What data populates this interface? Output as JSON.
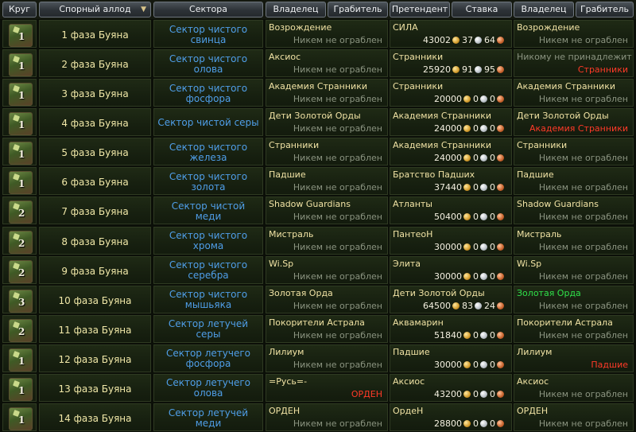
{
  "header": {
    "round": "Круг",
    "allod": "Спорный аллод",
    "sectors": "Сектора",
    "owner": "Владелец",
    "robber": "Грабитель",
    "claimant": "Претендент",
    "stake": "Ставка",
    "owner2": "Владелец",
    "robber2": "Грабитель",
    "sort_icon": "sort-desc-arrow"
  },
  "rows": [
    {
      "round": "1",
      "allod": "1 фаза Буяна",
      "sector": "Сектор чистого свинца",
      "owner": "Возрождение",
      "robber": "Никем не ограблен",
      "robber_style": "gray",
      "claimant": "СИЛА",
      "gold": "43002",
      "silver": "37",
      "copper": "64",
      "owner2": "Возрождение",
      "owner2_style": "normal",
      "robber2": "Никем не ограблен",
      "robber2_style": "gray"
    },
    {
      "round": "1",
      "allod": "2 фаза Буяна",
      "sector": "Сектор чистого олова",
      "owner": "Аксиос",
      "robber": "Никем не ограблен",
      "robber_style": "gray",
      "claimant": "Странники",
      "gold": "25920",
      "silver": "91",
      "copper": "95",
      "owner2": "Никому не принадлежит",
      "owner2_style": "gray",
      "robber2": "Странники",
      "robber2_style": "red"
    },
    {
      "round": "1",
      "allod": "3 фаза Буяна",
      "sector": "Сектор чистого фосфора",
      "owner": "Академия Странники",
      "robber": "Никем не ограблен",
      "robber_style": "gray",
      "claimant": "Странники",
      "gold": "20000",
      "silver": "0",
      "copper": "0",
      "owner2": "Академия Странники",
      "owner2_style": "normal",
      "robber2": "Никем не ограблен",
      "robber2_style": "gray"
    },
    {
      "round": "1",
      "allod": "4 фаза Буяна",
      "sector": "Сектор чистой серы",
      "owner": "Дети Золотой Орды",
      "robber": "Никем не ограблен",
      "robber_style": "gray",
      "claimant": "Академия Странники",
      "gold": "24000",
      "silver": "0",
      "copper": "0",
      "owner2": "Дети Золотой Орды",
      "owner2_style": "normal",
      "robber2": "Академия Странники",
      "robber2_style": "red"
    },
    {
      "round": "1",
      "allod": "5 фаза Буяна",
      "sector": "Сектор чистого железа",
      "owner": "Странники",
      "robber": "Никем не ограблен",
      "robber_style": "gray",
      "claimant": "Академия Странники",
      "gold": "24000",
      "silver": "0",
      "copper": "0",
      "owner2": "Странники",
      "owner2_style": "normal",
      "robber2": "Никем не ограблен",
      "robber2_style": "gray"
    },
    {
      "round": "1",
      "allod": "6 фаза Буяна",
      "sector": "Сектор чистого золота",
      "owner": "Падшие",
      "robber": "Никем не ограблен",
      "robber_style": "gray",
      "claimant": "Братство Падших",
      "gold": "37440",
      "silver": "0",
      "copper": "0",
      "owner2": "Падшие",
      "owner2_style": "normal",
      "robber2": "Никем не ограблен",
      "robber2_style": "gray"
    },
    {
      "round": "2",
      "allod": "7 фаза Буяна",
      "sector": "Сектор чистой меди",
      "owner": "Shadow Guardians",
      "robber": "Никем не ограблен",
      "robber_style": "gray",
      "claimant": "Атланты",
      "gold": "50400",
      "silver": "0",
      "copper": "0",
      "owner2": "Shadow Guardians",
      "owner2_style": "normal",
      "robber2": "Никем не ограблен",
      "robber2_style": "gray"
    },
    {
      "round": "2",
      "allod": "8 фаза Буяна",
      "sector": "Сектор чистого хрома",
      "owner": "Мистраль",
      "robber": "Никем не ограблен",
      "robber_style": "gray",
      "claimant": "ПантеоН",
      "gold": "30000",
      "silver": "0",
      "copper": "0",
      "owner2": "Мистраль",
      "owner2_style": "normal",
      "robber2": "Никем не ограблен",
      "robber2_style": "gray"
    },
    {
      "round": "2",
      "allod": "9 фаза Буяна",
      "sector": "Сектор чистого серебра",
      "owner": "Wi.Sp",
      "robber": "Никем не ограблен",
      "robber_style": "gray",
      "claimant": "Элита",
      "gold": "30000",
      "silver": "0",
      "copper": "0",
      "owner2": "Wi.Sp",
      "owner2_style": "normal",
      "robber2": "Никем не ограблен",
      "robber2_style": "gray"
    },
    {
      "round": "3",
      "allod": "10 фаза Буяна",
      "sector": "Сектор чистого мышьяка",
      "owner": "Золотая Орда",
      "robber": "Никем не ограблен",
      "robber_style": "gray",
      "claimant": "Дети Золотой Орды",
      "gold": "64500",
      "silver": "83",
      "copper": "24",
      "owner2": "Золотая Орда",
      "owner2_style": "green",
      "robber2": "Никем не ограблен",
      "robber2_style": "gray"
    },
    {
      "round": "2",
      "allod": "11 фаза Буяна",
      "sector": "Сектор летучей серы",
      "owner": "Покорители Астрала",
      "robber": "Никем не ограблен",
      "robber_style": "gray",
      "claimant": "Аквамарин",
      "gold": "51840",
      "silver": "0",
      "copper": "0",
      "owner2": "Покорители Астрала",
      "owner2_style": "normal",
      "robber2": "Никем не ограблен",
      "robber2_style": "gray"
    },
    {
      "round": "1",
      "allod": "12 фаза Буяна",
      "sector": "Сектор летучего фосфора",
      "owner": "Лилиум",
      "robber": "Никем не ограблен",
      "robber_style": "gray",
      "claimant": "Падшие",
      "gold": "30000",
      "silver": "0",
      "copper": "0",
      "owner2": "Лилиум",
      "owner2_style": "normal",
      "robber2": "Падшие",
      "robber2_style": "red"
    },
    {
      "round": "1",
      "allod": "13 фаза Буяна",
      "sector": "Сектор летучего олова",
      "owner": "=Русь=-",
      "robber": "ОРДЕН",
      "robber_style": "red",
      "claimant": "Аксиос",
      "gold": "43200",
      "silver": "0",
      "copper": "0",
      "owner2": "Аксиос",
      "owner2_style": "normal",
      "robber2": "Никем не ограблен",
      "robber2_style": "gray"
    },
    {
      "round": "1",
      "allod": "14 фаза Буяна",
      "sector": "Сектор летучей меди",
      "owner": "ОРДЕН",
      "robber": "Никем не ограблен",
      "robber_style": "gray",
      "claimant": "ОрдеН",
      "gold": "28800",
      "silver": "0",
      "copper": "0",
      "owner2": "ОРДЕН",
      "owner2_style": "normal",
      "robber2": "Никем не ограблен",
      "robber2_style": "gray"
    }
  ]
}
